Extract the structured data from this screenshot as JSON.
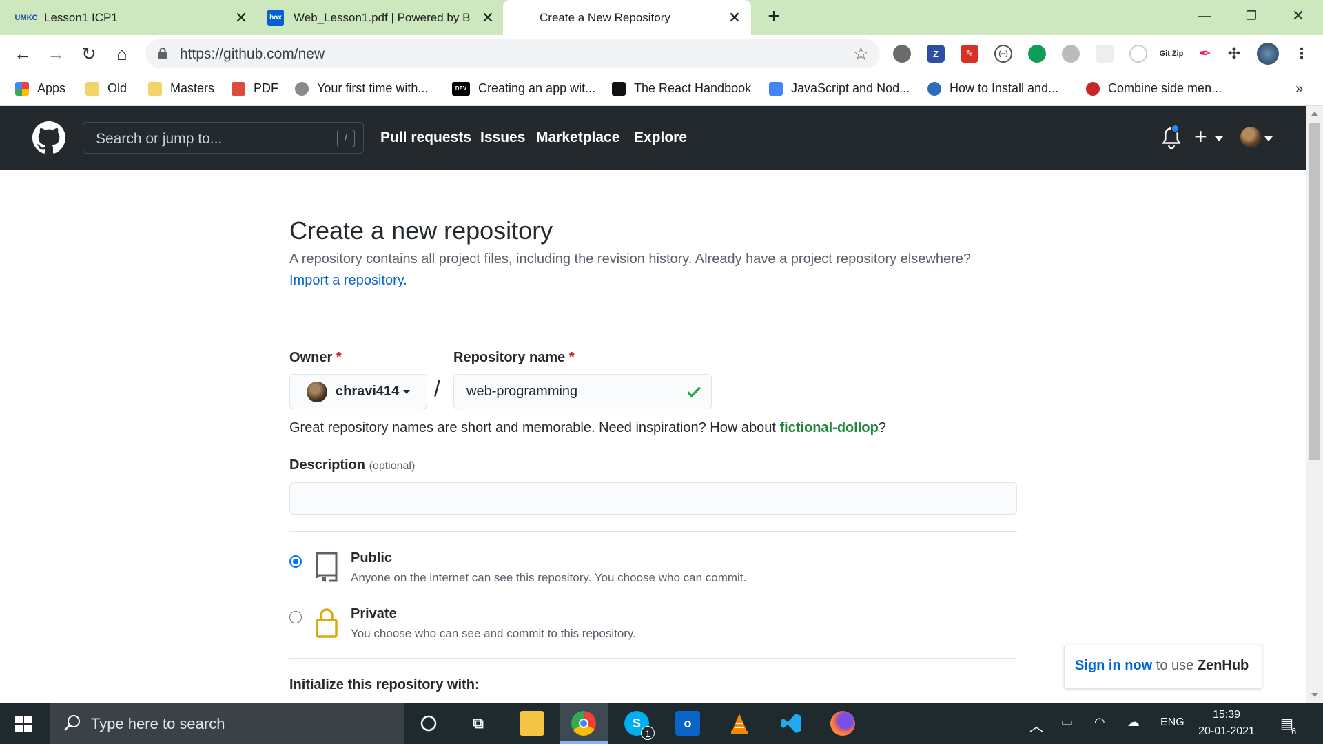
{
  "browser": {
    "tabs": [
      {
        "title": "Lesson1 ICP1",
        "fav": "UMKC"
      },
      {
        "title": "Web_Lesson1.pdf | Powered by B",
        "fav": "box"
      },
      {
        "title": "Create a New Repository",
        "fav": ""
      }
    ],
    "url": "https://github.com/new",
    "bookmarks": [
      {
        "label": "Apps"
      },
      {
        "label": "Old"
      },
      {
        "label": "Masters"
      },
      {
        "label": "PDF"
      },
      {
        "label": "Your first time with..."
      },
      {
        "label": "Creating an app wit...",
        "fav": "DEV"
      },
      {
        "label": "The React Handbook"
      },
      {
        "label": "JavaScript and Nod..."
      },
      {
        "label": "How to Install and..."
      },
      {
        "label": "Combine side men..."
      }
    ],
    "more_bookmarks": "»",
    "extensions": [
      "Z",
      "Git Zip"
    ]
  },
  "github": {
    "search_placeholder": "Search or jump to...",
    "search_shortcut": "/",
    "nav": [
      "Pull requests",
      "Issues",
      "Marketplace",
      "Explore"
    ]
  },
  "form": {
    "title": "Create a new repository",
    "subtitle": "A repository contains all project files, including the revision history. Already have a project repository elsewhere?",
    "import_link": "Import a repository.",
    "owner_label": "Owner",
    "required_mark": "*",
    "owner_value": "chravi414",
    "separator": "/",
    "repo_label": "Repository name",
    "repo_value": "web-programming",
    "hint_prefix": "Great repository names are short and memorable. Need inspiration? How about ",
    "hint_suggestion": "fictional-dollop",
    "hint_suffix": "?",
    "description_label": "Description",
    "description_optional": "(optional)",
    "description_value": "",
    "visibility": [
      {
        "title": "Public",
        "desc": "Anyone on the internet can see this repository. You choose who can commit.",
        "checked": true
      },
      {
        "title": "Private",
        "desc": "You choose who can see and commit to this repository.",
        "checked": false
      }
    ],
    "init_label": "Initialize this repository with:"
  },
  "zenhub": {
    "link": "Sign in now",
    "middle": " to use ",
    "brand": "ZenHub"
  },
  "taskbar": {
    "search_placeholder": "Type here to search",
    "skype_badge": "1",
    "language": "ENG",
    "time": "15:39",
    "date": "20-01-2021",
    "notifications": "6"
  },
  "colors": {
    "accent_link": "#0366d6",
    "suggestion_green": "#22863a",
    "header_bg": "#24292e",
    "tab_bar": "#cde8bf"
  }
}
